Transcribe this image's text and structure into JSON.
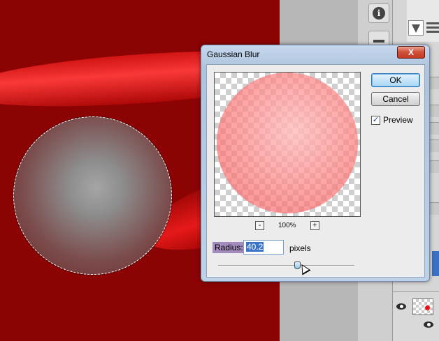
{
  "dialog": {
    "title": "Gaussian Blur",
    "close_label": "X",
    "ok_label": "OK",
    "cancel_label": "Cancel",
    "preview_label": "Preview",
    "preview_checked": true,
    "zoom_minus": "-",
    "zoom_plus": "+",
    "zoom_level": "100%",
    "radius_label": "Radius:",
    "radius_value": "40.2",
    "radius_units": "pixels",
    "slider_position": 0.58
  },
  "panels": {
    "info_icon_label": "i"
  },
  "colors": {
    "canvas_red": "#8c0303",
    "selection_border": "#ffffff",
    "radius_highlight": "#a48bbd",
    "ok_border": "#2f76b8"
  }
}
